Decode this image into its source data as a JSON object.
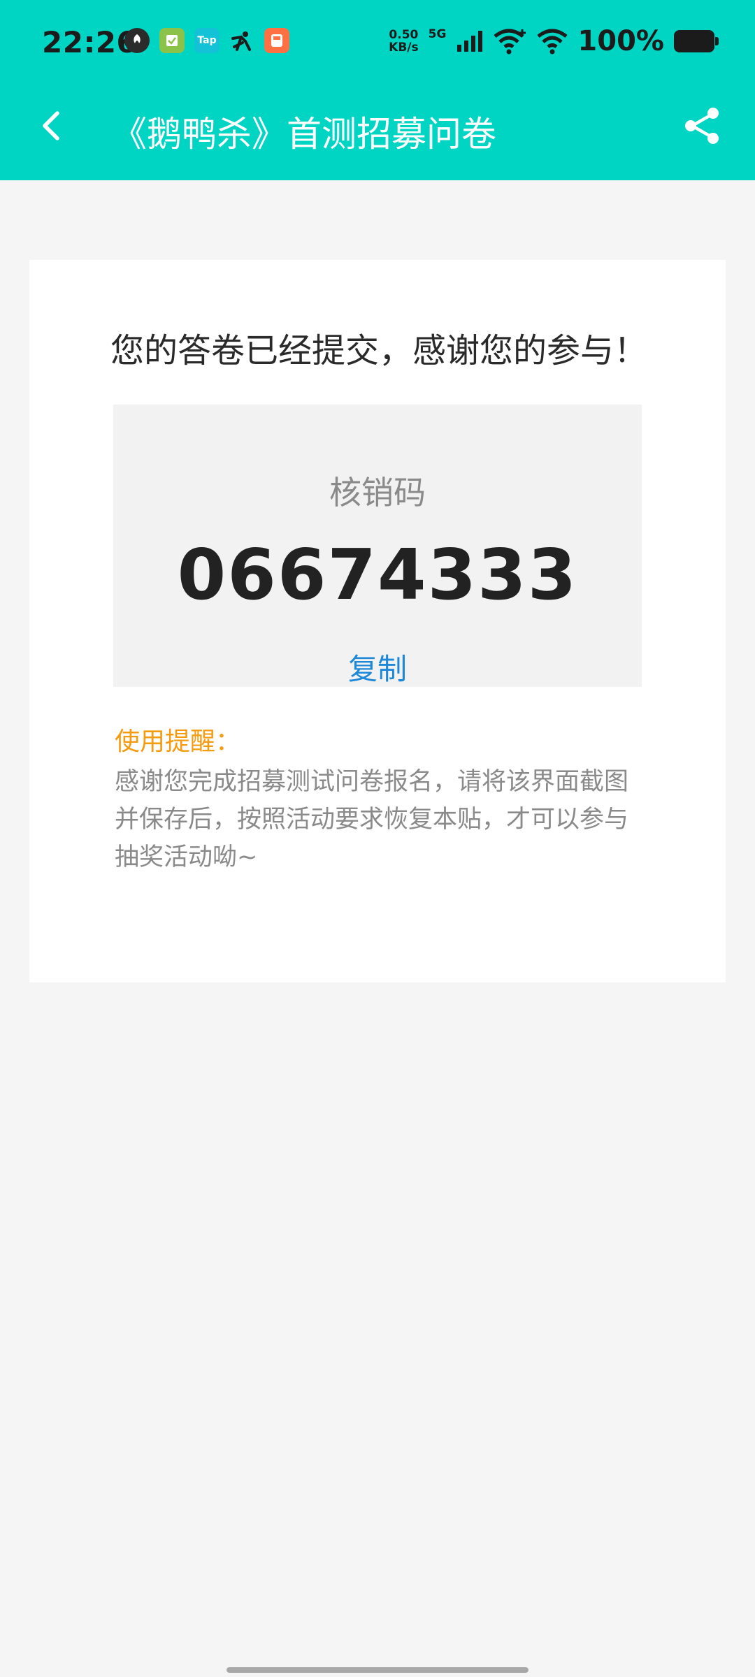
{
  "status_bar": {
    "time": "22:26",
    "net_speed_value": "0.50",
    "net_speed_unit": "KB/s",
    "network": "5G",
    "battery_percent": "100%"
  },
  "app_bar": {
    "title": "《鹅鸭杀》首测招募问卷"
  },
  "card": {
    "message": "您的答卷已经提交，感谢您的参与！",
    "code_label": "核销码",
    "code_value": "06674333",
    "copy_label": "复制",
    "tips_title": "使用提醒：",
    "tips_body": "感谢您完成招募测试问卷报名，请将该界面截图并保存后，按照活动要求恢复本贴，才可以参与抽奖活动呦~"
  },
  "colors": {
    "header_bg": "#00d4c3",
    "copy_link": "#1e88d8",
    "tips_title": "#f39c12"
  }
}
